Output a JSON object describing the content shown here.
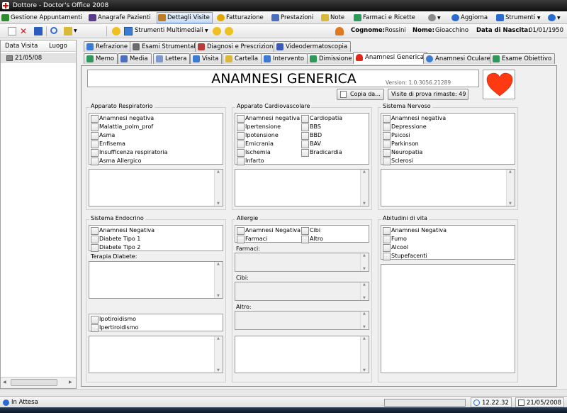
{
  "window": {
    "title": "Dottore - Doctor's Office 2008"
  },
  "menu": [
    {
      "label": "Gestione Appuntamenti",
      "icon": "calendar-icon",
      "color": "#2f8a2f"
    },
    {
      "label": "Anagrafe Pazienti",
      "icon": "people-icon",
      "color": "#5a3a8a"
    },
    {
      "label": "Dettagli Visite",
      "icon": "visit-icon",
      "color": "#c07a20"
    },
    {
      "label": "Fatturazione",
      "icon": "coin-icon",
      "color": "#e0a800"
    },
    {
      "label": "Prestazioni",
      "icon": "folder-icon",
      "color": "#4a6fbf"
    },
    {
      "label": "Note",
      "icon": "note-icon",
      "color": "#d9b83a"
    },
    {
      "label": "Farmaci e Ricette",
      "icon": "pills-icon",
      "color": "#2e9a5a"
    },
    {
      "label": "Aggiorna",
      "icon": "refresh-icon",
      "color": "#2a6bd0"
    },
    {
      "label": "Strumenti",
      "icon": "tools-icon",
      "color": "#2a6bd0"
    }
  ],
  "toolbar": {
    "multimedia_label": "Strumenti Multimediali",
    "cognome_label": "Cognome:",
    "cognome_value": "Rossini",
    "nome_label": "Nome:",
    "nome_value": "Gioacchino",
    "nascita_label": "Data di Nascita:",
    "nascita_value": "01/01/1950"
  },
  "left_panel": {
    "col_date": "Data Visita",
    "col_place": "Luogo",
    "rows": [
      {
        "date": "21/05/08",
        "place": ""
      }
    ]
  },
  "tabs_row1": [
    {
      "label": "Refrazione",
      "icon": "eye-tool-icon",
      "color": "#3a7bd5"
    },
    {
      "label": "Esami Strumentali",
      "icon": "exam-icon",
      "color": "#6a6a6a"
    },
    {
      "label": "Diagnosi e Prescrizioni",
      "icon": "book-icon",
      "color": "#b83a3a"
    },
    {
      "label": "Videodermatoscopia",
      "icon": "video-icon",
      "color": "#3a5ab8"
    }
  ],
  "tabs_row2": [
    {
      "label": "Memo",
      "icon": "pencil-icon",
      "color": "#2e9a5a"
    },
    {
      "label": "Media",
      "icon": "media-icon",
      "color": "#4a6fbf"
    },
    {
      "label": "Lettera",
      "icon": "letter-icon",
      "color": "#7a9ad0"
    },
    {
      "label": "Visita",
      "icon": "stethoscope-icon",
      "color": "#3a7bd5"
    },
    {
      "label": "Cartella",
      "icon": "folder-icon",
      "color": "#d9b83a"
    },
    {
      "label": "Intervento",
      "icon": "surgeon-icon",
      "color": "#3a7bd5"
    },
    {
      "label": "Dimissione",
      "icon": "exit-icon",
      "color": "#2e9a5a"
    },
    {
      "label": "Anamnesi Generica",
      "icon": "heart-icon",
      "color": "#e0281a"
    },
    {
      "label": "Anamnesi Oculare",
      "icon": "eye-icon",
      "color": "#3a7bd5"
    },
    {
      "label": "Esame Obiettivo",
      "icon": "exam-cross-icon",
      "color": "#2e9a5a"
    }
  ],
  "main": {
    "title": "ANAMNESI GENERICA",
    "version": "Version: 1.0.3056.21289",
    "copy_button": "Copia da...",
    "trial_visits": "Visite di prova rimaste: 49",
    "heart_color": "#ff3a12"
  },
  "groups": {
    "respiratorio": {
      "title": "Apparato Respiratorio",
      "items": [
        "Anamnesi negativa",
        "Malattia_polm_prof",
        "Asma",
        "Enfisema",
        "Insufficenza respiratoria",
        "Asma Allergico"
      ]
    },
    "cardio": {
      "title": "Apparato Cardiovascolare",
      "col1": [
        "Anamnesi negativa",
        "Ipertensione",
        "Ipotensione",
        "Emicrania",
        "Ischemia",
        "Infarto"
      ],
      "col2": [
        "Cardiopatia",
        "BBS",
        "BBD",
        "BAV",
        "Bradicardia"
      ]
    },
    "nervoso": {
      "title": "Sistema Nervoso",
      "items": [
        "Anamnesi negativa",
        "Depressione",
        "Psicosi",
        "Parkinson",
        "Neuropatia",
        "Sclerosi"
      ]
    },
    "endocrino": {
      "title": "Sistema Endocrino",
      "items": [
        "Anamnesi Negativa",
        "Diabete Tipo 1",
        "Diabete Tipo 2"
      ],
      "terapia_label": "Terapia Diabete:",
      "items2": [
        "Ipotiroidismo",
        "Ipertiroidismo"
      ]
    },
    "allergie": {
      "title": "Allergie",
      "col1": [
        "Anamnesi Negativa",
        "Farmaci"
      ],
      "col2": [
        "Cibi",
        "Altro"
      ],
      "farmaci_label": "Farmaci:",
      "cibi_label": "Cibi:",
      "altro_label": "Altro:"
    },
    "abitudini": {
      "title": "Abitudini di vita",
      "items": [
        "Anamnesi Negativa",
        "Fumo",
        "Alcool",
        "Stupefacenti"
      ]
    }
  },
  "status": {
    "text": "In Attesa",
    "time": "12.22.32",
    "date": "21/05/2008"
  }
}
